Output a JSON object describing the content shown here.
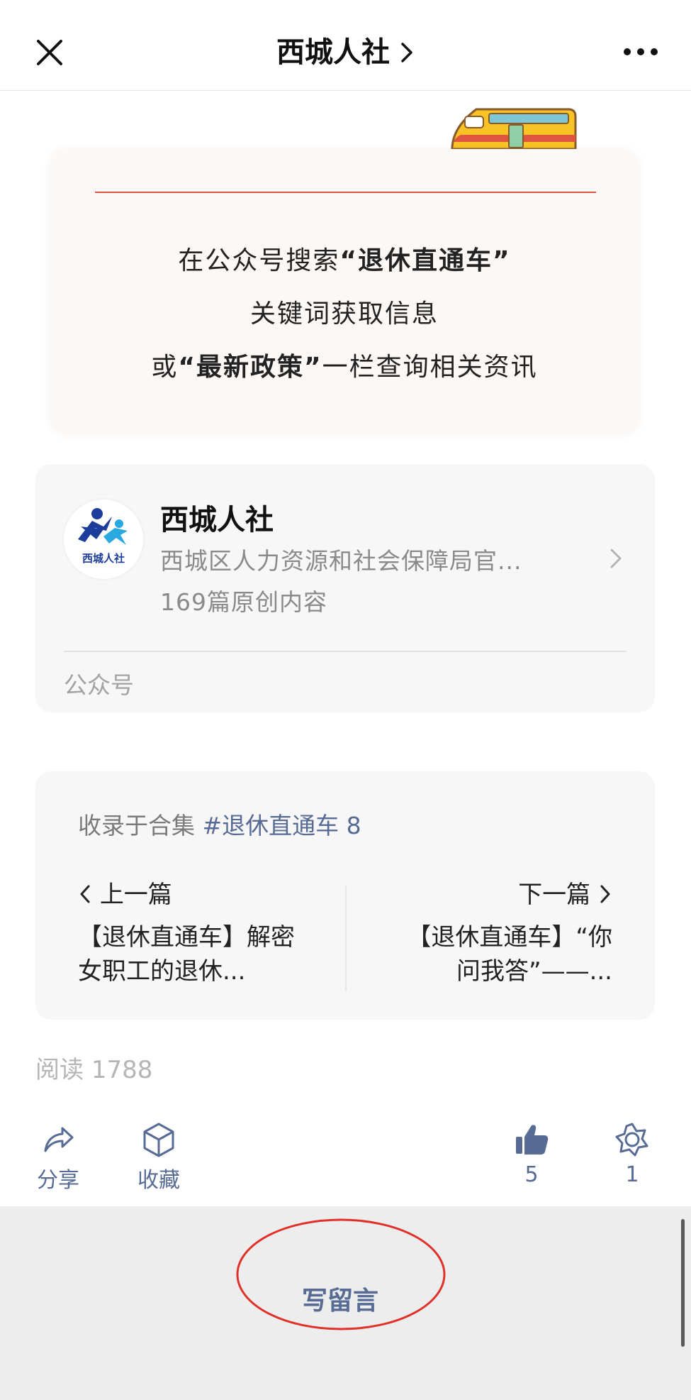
{
  "nav": {
    "title": "西城人社",
    "close_icon": "close-icon",
    "more_icon": "more-dots-icon"
  },
  "banner": {
    "line1_pre": "在公众号搜索",
    "line1_bold": "“退休直通车”",
    "line2": "关键词获取信息",
    "line3_pre": "或",
    "line3_bold": "“最新政策”",
    "line3_post": "一栏查询相关资讯",
    "accent_color": "#e0553f"
  },
  "account": {
    "name": "西城人社",
    "description": "西城区人力资源和社会保障局官...",
    "original_count": "169篇原创内容",
    "type_label": "公众号",
    "logo_text": "西城人社"
  },
  "collection": {
    "prefix": "收录于合集",
    "tag": "#退休直通车",
    "count": "8",
    "prev_label": "上一篇",
    "prev_title": "【退休直通车】解密女职工的退休...",
    "next_label": "下一篇",
    "next_title": "【退休直通车】“你问我答”——..."
  },
  "stats": {
    "read_label": "阅读",
    "read_count": "1788"
  },
  "actions": {
    "share_label": "分享",
    "collect_label": "收藏",
    "like_count": "5",
    "wow_count": "1",
    "accent_color": "#576b95"
  },
  "comment": {
    "button_label": "写留言",
    "highlight_color": "#e0302a"
  }
}
